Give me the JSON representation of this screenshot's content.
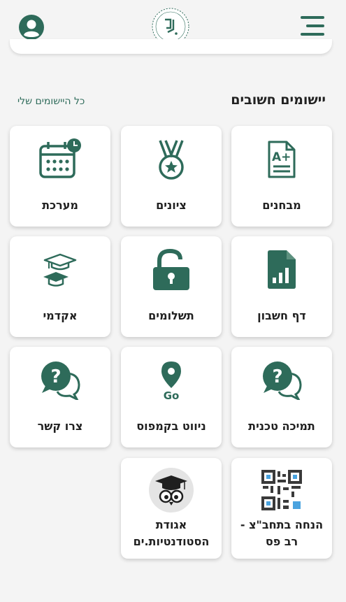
{
  "header": {
    "avatar_icon": "user-avatar-icon",
    "logo_icon": "college-logo-icon",
    "menu_icon": "hamburger-menu-icon"
  },
  "section": {
    "title": "יישומים חשובים",
    "all_link": "כל היישומים שלי"
  },
  "colors": {
    "primary": "#2e6b5a",
    "background": "#f4f4f4",
    "tile": "#ffffff"
  },
  "apps": [
    {
      "label": "מבחנים",
      "icon": "exam-grade-icon"
    },
    {
      "label": "ציונים",
      "icon": "medal-icon"
    },
    {
      "label": "מערכת",
      "icon": "calendar-clock-icon"
    },
    {
      "label": "דף חשבון",
      "icon": "report-file-icon"
    },
    {
      "label": "תשלומים",
      "icon": "unlock-icon"
    },
    {
      "label": "אקדמי",
      "icon": "graduation-caps-icon"
    },
    {
      "label": "תמיכה טכנית",
      "icon": "help-chat-icon"
    },
    {
      "label": "ניווט בקמפוס",
      "icon": "map-pin-go-icon"
    },
    {
      "label": "צרו קשר",
      "icon": "contact-chat-icon"
    },
    {
      "label": "הנחה בתחב\"צ - רב פס",
      "icon": "qr-code-icon"
    },
    {
      "label": "אגודת הסטודנטיות.ים",
      "icon": "owl-graduate-icon"
    }
  ]
}
